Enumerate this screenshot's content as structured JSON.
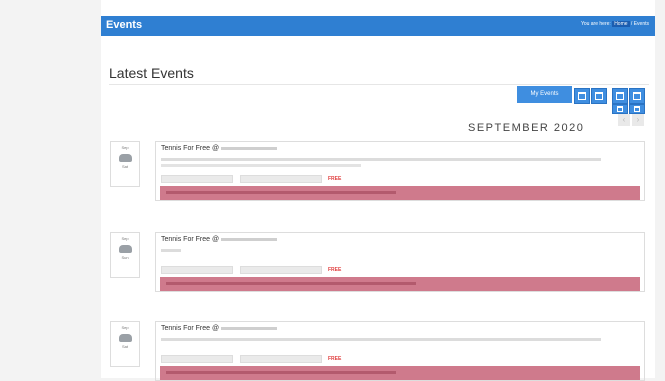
{
  "header": {
    "title": "Events",
    "breadcrumb_prefix": "You are here:",
    "breadcrumb_home": "Home",
    "breadcrumb_sep": "/",
    "breadcrumb_current": "Events"
  },
  "main": {
    "heading": "Latest Events",
    "my_events_label": "My Events",
    "view_icons": [
      "calendar-day-icon",
      "calendar-week-icon",
      "calendar-month-icon",
      "list-view-icon",
      "grid-view-icon",
      "calendar-icon"
    ],
    "month_label": "SEPTEMBER 2020",
    "prev_label": "‹",
    "next_label": "›"
  },
  "events": [
    {
      "month": "Sep",
      "day": "Sat",
      "weather_icon": "cloud-icon",
      "title": "Tennis For Free @",
      "free": "FREE"
    },
    {
      "month": "Sep",
      "day": "Sun",
      "weather_icon": "cloud-icon",
      "title": "Tennis For Free @",
      "free": "FREE"
    },
    {
      "month": "Sep",
      "day": "Sat",
      "weather_icon": "cloud-icon",
      "title": "Tennis For Free @",
      "free": "FREE"
    }
  ],
  "colors": {
    "header_bg": "#2f7fd2",
    "button_bg": "#3f8ee0",
    "notice_bg": "#cf7a8c",
    "free_text": "#e04040"
  }
}
